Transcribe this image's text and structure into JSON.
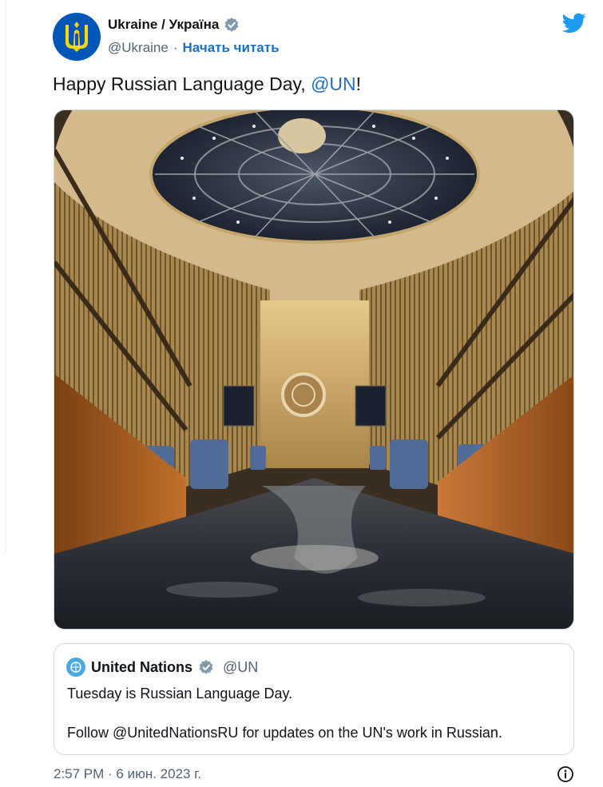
{
  "author": {
    "display_name": "Ukraine / Україна",
    "handle": "@Ukraine",
    "separator": "·",
    "follow_label": "Начать читать",
    "avatar_icon": "ukraine-trident-icon",
    "verified_icon": "verified-badge-icon"
  },
  "tweet": {
    "text_before": "Happy Russian Language Day, ",
    "mention": "@UN",
    "text_after": "!"
  },
  "media": {
    "icon": "un-general-assembly-hall-flooded-image"
  },
  "quote": {
    "display_name": "United Nations",
    "handle": "@UN",
    "line1": "Tuesday is Russian Language Day.",
    "line2": "Follow @UnitedNationsRU for updates on the UN's work in Russian."
  },
  "footer": {
    "timestamp": "2:57 PM · 6 июн. 2023 г.",
    "info_icon": "info-icon"
  },
  "colors": {
    "link": "#1d6fc4",
    "ukraine_blue": "#0057b7",
    "ukraine_yellow": "#ffd700",
    "twitter_blue": "#1d9bf0",
    "un_blue": "#4ca9df"
  }
}
